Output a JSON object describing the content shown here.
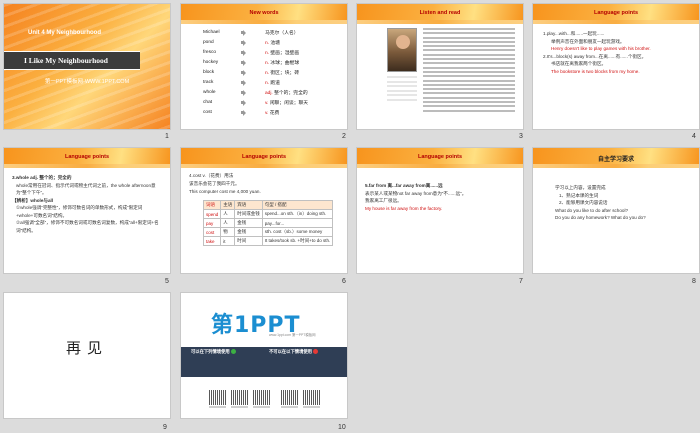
{
  "slides": [
    {
      "number": "1",
      "unit": "Unit 4 My Neighbourhood",
      "title": "I Like My Neighbourhood",
      "subtitle": "第一PPT模板网-WWW.1PPT.COM"
    },
    {
      "number": "2",
      "heading": "New words",
      "vocab": [
        {
          "word": "Michael",
          "pos": "",
          "meaning": "马克尔（人名）"
        },
        {
          "word": "pond",
          "pos": "n.",
          "meaning": "池塘"
        },
        {
          "word": "fresco",
          "pos": "n.",
          "meaning": "壁画；湿壁画"
        },
        {
          "word": "hockey",
          "pos": "n.",
          "meaning": "冰球；曲棍球"
        },
        {
          "word": "block",
          "pos": "n.",
          "meaning": "街区；块；砖"
        },
        {
          "word": "track",
          "pos": "n.",
          "meaning": "跑道"
        },
        {
          "word": "whole",
          "pos": "adj.",
          "meaning": "整个的；完全的"
        },
        {
          "word": "chat",
          "pos": "v.",
          "meaning": "闲聊；闲谈；聊天"
        },
        {
          "word": "cost",
          "pos": "v.",
          "meaning": "花费"
        }
      ]
    },
    {
      "number": "3",
      "heading": "Listen and read"
    },
    {
      "number": "4",
      "heading": "Language points",
      "lines": [
        {
          "text": "1.play...with...和......一起玩......",
          "tone": "normal"
        },
        {
          "text": "举例声音在外面和朋友一起玩游戏。",
          "tone": "normal"
        },
        {
          "text": "Henry doesn't like to play games with his brother.",
          "tone": "red"
        },
        {
          "text": "2.It's...block(s) away from...在离......有......个街区。",
          "tone": "normal"
        },
        {
          "text": "书店就在离我家两个街区。",
          "tone": "normal"
        },
        {
          "text": "The bookstore is two blocks from my home.",
          "tone": "red"
        }
      ]
    },
    {
      "number": "5",
      "heading": "Language points",
      "lines": [
        {
          "text": "3.whole adj. 整个的；完全的",
          "tone": "bold"
        },
        {
          "text": "whole常用在冠词、指示代词或物主代词之前，the whole afternoon意为“整个下午”。",
          "tone": "normal"
        },
        {
          "text": "【辨析】whole与all",
          "tone": "bold"
        },
        {
          "text": "①whole强调“完整性”，修饰可数名词的单数形式，构成“限定词+whole+可数名词”结构。",
          "tone": "normal"
        },
        {
          "text": "②all强调“全部”，修饰不可数名词或可数名词复数，构成“all+限定词+名词”结构。",
          "tone": "normal"
        }
      ]
    },
    {
      "number": "6",
      "heading": "Language points",
      "intro": "4.cost v.（花费）用法",
      "note": "该音乐会花了我四千元。",
      "example": "This computer cost me 4,000 yuan.",
      "table": {
        "headers": [
          "词语",
          "主语",
          "宾语",
          "句型 / 搭配"
        ],
        "rows": [
          [
            "spend",
            "人",
            "时间或金钱",
            "spend...on sth.（in）doing sth."
          ],
          [
            "pay",
            "人",
            "金钱",
            "pay...for..."
          ],
          [
            "cost",
            "物",
            "金钱",
            "sth. cost（sb.）some money"
          ],
          [
            "take",
            "it",
            "时间",
            "It takes/took sb. +时间+to do sth."
          ]
        ]
      }
    },
    {
      "number": "7",
      "heading": "Language points",
      "lines": [
        {
          "text": "5.far from 离...far away from离......远",
          "tone": "bold"
        },
        {
          "text": "表示某人或某物not far away from意为“不......远”。",
          "tone": "normal"
        },
        {
          "text": "我家离工厂很远。",
          "tone": "normal"
        },
        {
          "text": "My house is far away from the factory.",
          "tone": "red"
        }
      ]
    },
    {
      "number": "8",
      "heading": "自主学习要求",
      "lines": [
        {
          "text": "学习以上内容，设置完成",
          "tone": "normal"
        },
        {
          "text": "1、熟记本课的生词",
          "tone": "normal"
        },
        {
          "text": "2、能够用课文内容说话",
          "tone": "normal"
        },
        {
          "text": "What do you like to do after school?",
          "tone": "normal"
        },
        {
          "text": "Do you do any homework? What do you do?",
          "tone": "normal"
        }
      ]
    },
    {
      "number": "9",
      "text": "再见"
    },
    {
      "number": "10",
      "logo": "第1PPT",
      "tagline": "www.1ppt.com 第一PPT模板网",
      "allowed_title": "可以在下列情境使用",
      "forbidden_title": "不可以在以下情境使用"
    }
  ],
  "colors": {
    "accent_orange": "#f7941d",
    "heading_red": "#b40000",
    "text_red": "#d01010",
    "background": "#dcdcdc"
  }
}
